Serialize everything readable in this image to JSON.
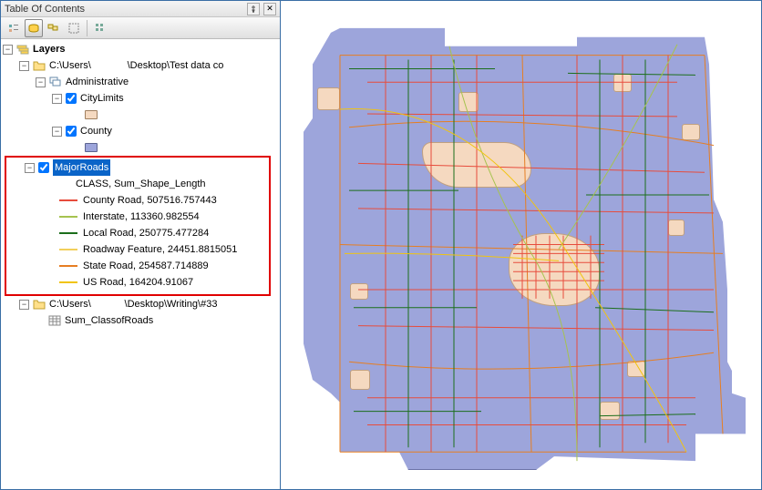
{
  "toc": {
    "title": "Table Of Contents",
    "rootLabel": "Layers",
    "path1": "C:\\Users\\",
    "path1b": "\\Desktop\\Test data co",
    "admin": "Administrative",
    "cityLimits": "CityLimits",
    "county": "County",
    "cityColor": "#f5d9c0",
    "countyColor": "#9da5db",
    "majorRoads": "MajorRoads",
    "classHeader": "CLASS, Sum_Shape_Length",
    "roads": [
      {
        "color": "#e74c3c",
        "label": "County Road, 507516.757443"
      },
      {
        "color": "#a6c34f",
        "label": "Interstate, 113360.982554"
      },
      {
        "color": "#1b6e1b",
        "label": "Local Road, 250775.477284"
      },
      {
        "color": "#f2cf5b",
        "label": "Roadway Feature, 24451.8815051"
      },
      {
        "color": "#e67e22",
        "label": "State Road, 254587.714889"
      },
      {
        "color": "#f1c40f",
        "label": "US Road, 164204.91067"
      }
    ],
    "path2a": "C:\\Users\\",
    "path2b": "\\Desktop\\Writing\\#33",
    "sumTable": "Sum_ClassofRoads"
  }
}
